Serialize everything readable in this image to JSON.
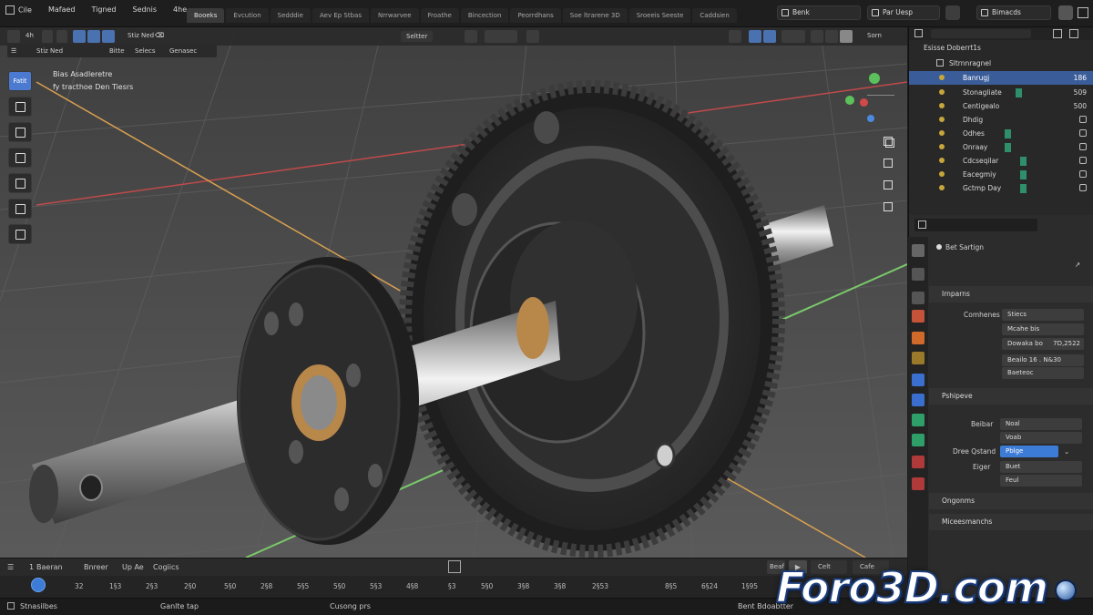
{
  "menu": {
    "items": [
      "Cile",
      "Mafaed",
      "Tigned",
      "Sednis",
      "4he"
    ]
  },
  "workspace_tabs": [
    "Booeks",
    "Evcution",
    "Sedddie",
    "Aev Ep Stbas",
    "Nrrwarvee",
    "Froathe",
    "Bincection",
    "Peorrdhans",
    "Soe ltrarene 3D",
    "Sroeeis Seeste",
    "Caddsien"
  ],
  "top_right": {
    "scene": "Benk",
    "view_layer": "Par Uesp",
    "render": "Bimacds"
  },
  "viewport": {
    "header": {
      "mode": "Stiz Ned",
      "view": "Bitte",
      "select": "Selecs",
      "add": "Uy",
      "object": "Genasec",
      "transform": "Seltter",
      "overlay": "Sorn"
    },
    "info": {
      "line1": "Bias Asadleretre",
      "line2": "fy tracthoe Den Tiesrs"
    },
    "tool_active_label": "Fatit",
    "viewport_fill": {
      "bg": "#4e4e4e",
      "x_axis": "#c04a4a",
      "y_axis": "#7ac96a",
      "grid": "#5d5d5d"
    }
  },
  "timeline": {
    "header": {
      "frame": "1",
      "label1": "Baeran",
      "label2": "Bnreer",
      "label3": "Up Ae",
      "label4": "Cogiics",
      "play_label": "Beaf",
      "start": "Celt",
      "end": "Cafe"
    },
    "frames": [
      "32",
      "1§3",
      "2§3",
      "2§0",
      "5§0",
      "2§8",
      "5§5",
      "5§0",
      "5§3",
      "4§8",
      "§3",
      "5§0",
      "3§8",
      "3§8",
      "2§53",
      "8§5",
      "6§24",
      "1§95"
    ]
  },
  "status": {
    "left": "Stnasilbes",
    "mid": "Ganlte tap",
    "right": "Cusong prs",
    "far": "Bent Bdoabtter"
  },
  "outliner": {
    "header": "Esisse Doberrt1s",
    "collection": "Sltrnnragnel",
    "items": [
      {
        "label": "Banrugj",
        "num": "186",
        "selected": true
      },
      {
        "label": "Stonagliate",
        "num": "509",
        "selected": false
      },
      {
        "label": "Centigealo",
        "num": "500",
        "selected": false
      },
      {
        "label": "Dhdig",
        "num": "§",
        "selected": false
      },
      {
        "label": "Odhes",
        "num": "§",
        "selected": false
      },
      {
        "label": "Onraay",
        "num": "§",
        "selected": false
      },
      {
        "label": "Cdcseqilar",
        "num": "§",
        "selected": false
      },
      {
        "label": "Eacegmiy",
        "num": "§",
        "selected": false
      },
      {
        "label": "Gctmp Day",
        "num": "§",
        "selected": false
      }
    ]
  },
  "properties": {
    "object_name": "Bet Sartign",
    "panel1": {
      "title": "Irnparns",
      "label": "Comhenes",
      "fields": [
        "Stiecs",
        "Mcahe bis",
        "Dowaka bo"
      ],
      "values": [
        "",
        "",
        "7D,2522"
      ],
      "row": "Beailo 16 . N&30",
      "row2": "Baeteoc"
    },
    "panel2": {
      "title": "Pshipeve"
    },
    "panel3": {
      "label_a": "Beibar",
      "val_a1": "Noal",
      "val_a2": "Voab",
      "label_b": "Dree Qstand",
      "val_b": "Pblge",
      "label_c": "Eiger",
      "val_c1": "Buet",
      "val_c2": "Feul"
    },
    "sections": [
      "Ongonms",
      "Miceesmanchs"
    ]
  },
  "watermark": "Foro3D.com"
}
